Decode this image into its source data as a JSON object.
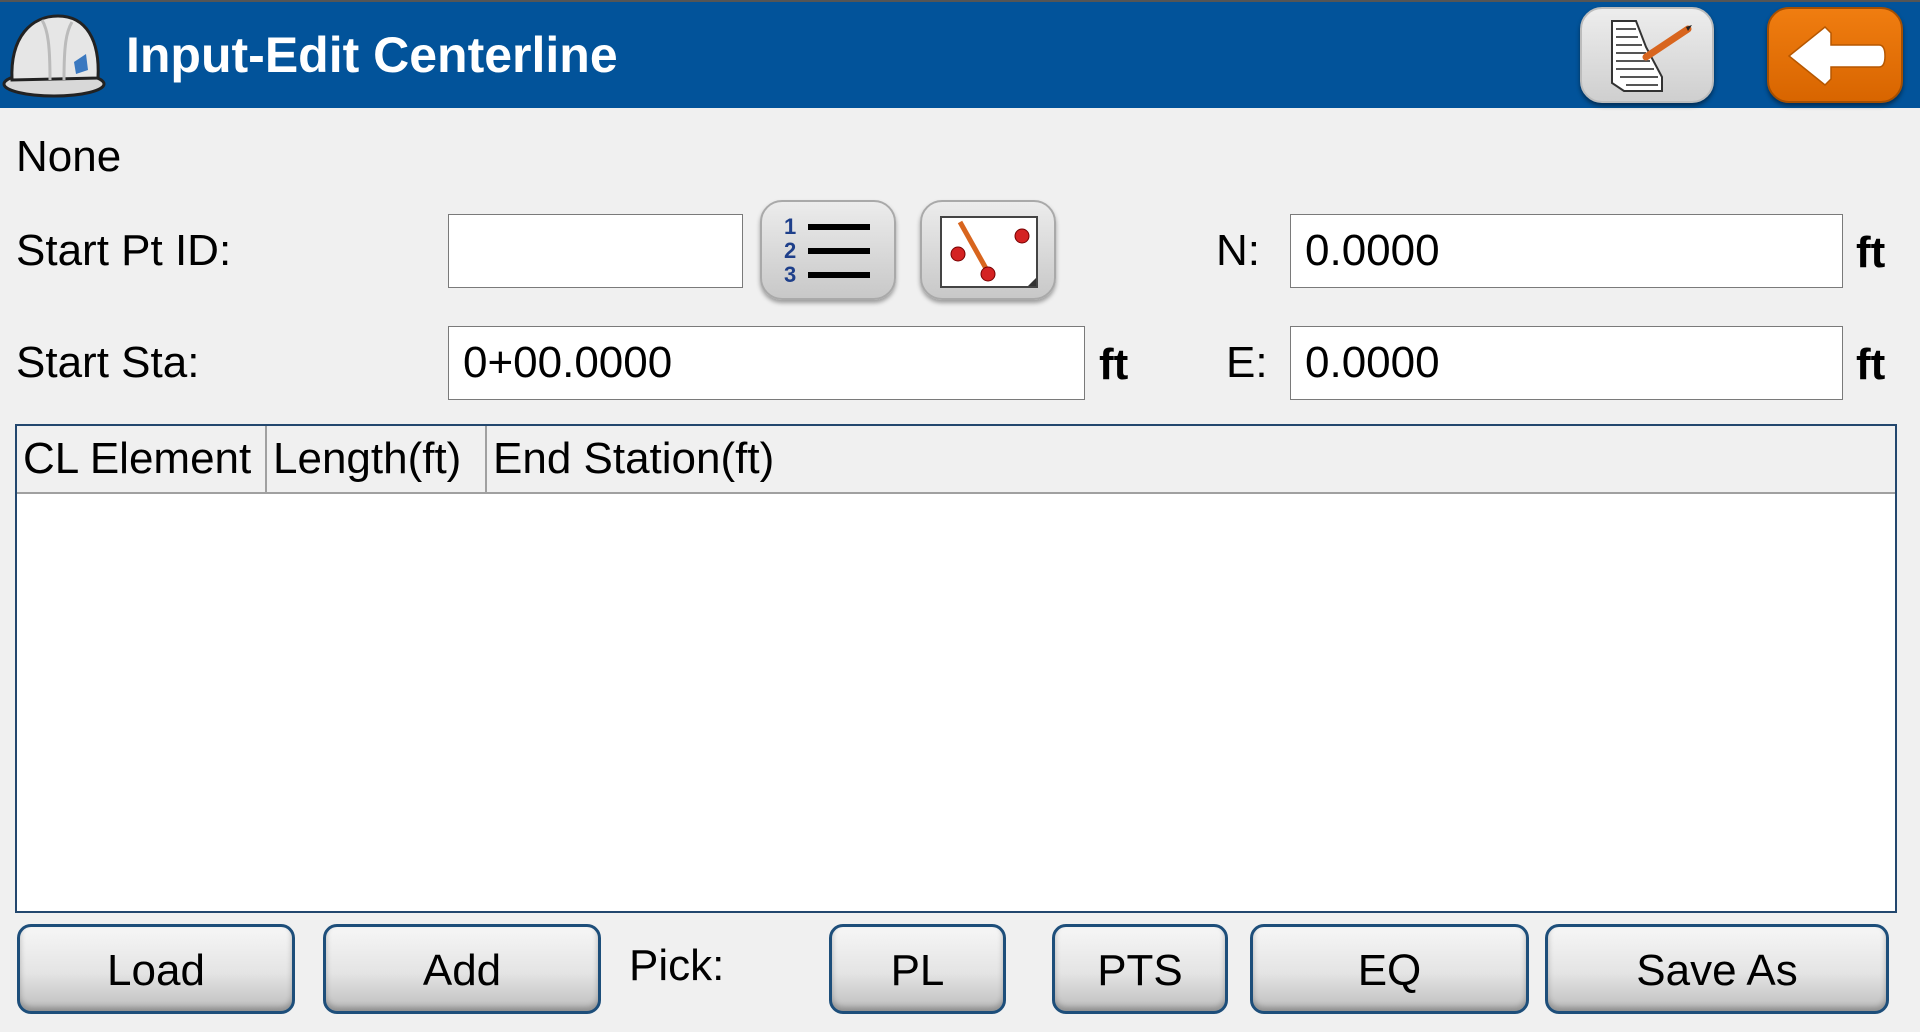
{
  "header": {
    "title": "Input-Edit Centerline",
    "app_icon": "hard-hat-icon",
    "notes_button_icon": "notes-pencil-icon",
    "back_button_icon": "back-arrow-icon",
    "colors": {
      "bar": "#02539a",
      "back_button": "#e87000"
    }
  },
  "status_text": "None",
  "form": {
    "start_pt_id": {
      "label": "Start Pt ID:",
      "value": "",
      "list_button_icon": "numbered-list-icon",
      "map_button_icon": "map-pick-icon"
    },
    "start_sta": {
      "label": "Start Sta:",
      "value": "0+00.0000",
      "unit": "ft"
    },
    "northing": {
      "label": "N:",
      "value": "0.0000",
      "unit": "ft"
    },
    "easting": {
      "label": "E:",
      "value": "0.0000",
      "unit": "ft"
    }
  },
  "table": {
    "columns": [
      "CL Element",
      "Length(ft)",
      "End Station(ft)"
    ],
    "rows": []
  },
  "footer": {
    "load": "Load",
    "add": "Add",
    "pick_label": "Pick:",
    "pl": "PL",
    "pts": "PTS",
    "eq": "EQ",
    "save_as": "Save As"
  }
}
